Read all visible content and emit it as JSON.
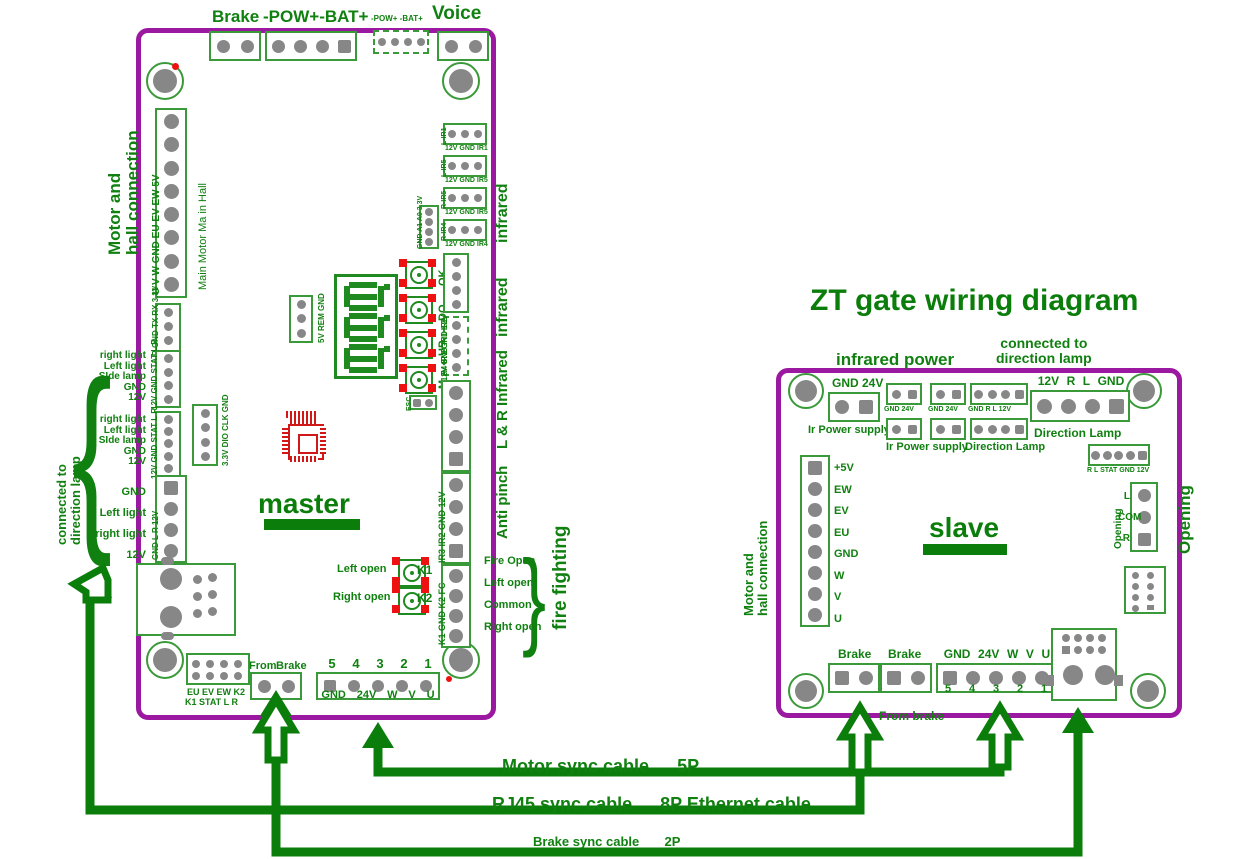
{
  "title": "ZT gate wiring diagram",
  "colors": {
    "board_outline": "#9b19a0",
    "connector": "#3a9a3a",
    "text": "#108010",
    "title": "#0b7d0b",
    "pin": "#878787",
    "pad": "#ee1111"
  },
  "master": {
    "name_label": "master",
    "top": {
      "brake": "Brake",
      "pow_bat": "-POW+-BAT+",
      "pow_bat_small": "-POW+  -BAT+",
      "voice": "Voice"
    },
    "left": {
      "motor_hall": "Motor and\nhall connection",
      "motor_hall_line1": "Motor and",
      "motor_hall_line2": "hall connection",
      "main_motor_in_hall": "Main  Motor   Ma   in   Hall",
      "main_motor_pins": [
        "U",
        "V",
        "W",
        "GND",
        "EU",
        "EV",
        "EW",
        "5V"
      ],
      "uart_pins": "L R GND TX RX 3.3V",
      "dir_lamp_group": "connected to\ndirection lamp",
      "dir_lamp_group_line1": "connected to",
      "dir_lamp_group_line2": "direction lamp",
      "lamp1_pins": "12V GND STAT L R",
      "lamp1_labels": [
        "right light",
        "Left light",
        "SIde lamp",
        "GND",
        "12V"
      ],
      "lamp2_pins": "12V GND STAT L R",
      "lamp2_labels": [
        "right light",
        "Left light",
        "SIde lamp",
        "GND",
        "12V"
      ],
      "prog_pins": "3.3V DIO CLK GND",
      "lamp3_labels": [
        "GND",
        "Left light",
        "right light",
        "12V"
      ],
      "lamp3_pins": "GND L R 12V"
    },
    "right": {
      "ir_connectors": [
        {
          "name": "L-IR1",
          "pins": "12V GND IR1"
        },
        {
          "name": "L-IR5",
          "pins": "12V GND IR5"
        },
        {
          "name": "R-IR5",
          "pins": "12V GND IR5"
        },
        {
          "name": "R-IR4",
          "pins": "12V GND IR4"
        }
      ],
      "addr_pins": "GND A1 A0 3.3V",
      "infrared_1": "infrared",
      "infrared_2": "infrared",
      "infrared_3": "infrared",
      "lr_infrared": "L & R Infrared",
      "lr_ir_pins": "R4  IR1 GND 12V",
      "anti_pinch": "Anti pinch",
      "anti_pinch_pins": "IR3 IR2 GND 12V",
      "fire_fighting": "fire fighting",
      "fire_pins": "K1 GND K2 FC",
      "fire_labels": [
        "Fire Open",
        "Left open",
        "Common",
        "Right open"
      ]
    },
    "center": {
      "display_digits": "888",
      "remote_pins": "5V REM GND",
      "buttons": [
        "OK",
        "DO",
        "UP",
        "M"
      ],
      "esc_button": "ESC",
      "relay_k1_label": "Left open",
      "relay_k1": "K1",
      "relay_k2_label": "Right open",
      "relay_k2": "K2"
    },
    "bottom": {
      "header_row1": "EU EV EW K2",
      "header_row2": "K1 STAT L R",
      "from": "From",
      "brake": "Brake",
      "motor_numbers": [
        "5",
        "4",
        "3",
        "2",
        "1"
      ],
      "motor_names": [
        "GND",
        "24V",
        "W",
        "V",
        "U"
      ]
    }
  },
  "slave": {
    "name_label": "slave",
    "top": {
      "infrared_power": "infrared  power",
      "connected_dir_lamp_line1": "connected to",
      "connected_dir_lamp_line2": "direction lamp",
      "gnd24v": "GND 24V",
      "ir_power_supply_1": "Ir Power supply",
      "ir_power_supply_2": "Ir Power supply",
      "small_gnd24v_a": "GND 24V",
      "small_gnd24v_b": "GND 24V",
      "small_gnd24v_c": "GND 24V",
      "small_gnd24v_d": "GND 24V",
      "dir_lamp_small_pins": "GND  R   L  12V",
      "direction_lamp_small": "Direction Lamp",
      "dir_lamp_big_pins": [
        "12V",
        "R",
        "L",
        "GND"
      ],
      "direction_lamp_big": "Direction Lamp",
      "stat_pins": "R  L  STAT GND 12V"
    },
    "left": {
      "motor_hall_line1": "Motor and",
      "motor_hall_line2": "hall connection",
      "motor_pins": [
        "+5V",
        "EW",
        "EV",
        "EU",
        "GND",
        "W",
        "V",
        "U"
      ]
    },
    "right": {
      "opening": "Opening",
      "opening_small": "Opening",
      "opening_pins": [
        "L",
        "COM",
        "R"
      ]
    },
    "bottom": {
      "brake_1": "Brake",
      "brake_2": "Brake",
      "from_brake": "From brake",
      "motor_names": [
        "GND",
        "24V",
        "W",
        "V",
        "U"
      ],
      "motor_numbers": [
        "5",
        "4",
        "3",
        "2",
        "1"
      ]
    }
  },
  "cables": [
    {
      "label": "Motor sync cable",
      "spec": "5P"
    },
    {
      "label": "RJ45 sync cable",
      "spec": "8P Ethernet cable"
    },
    {
      "label": "Brake sync cable",
      "spec": "2P"
    }
  ]
}
